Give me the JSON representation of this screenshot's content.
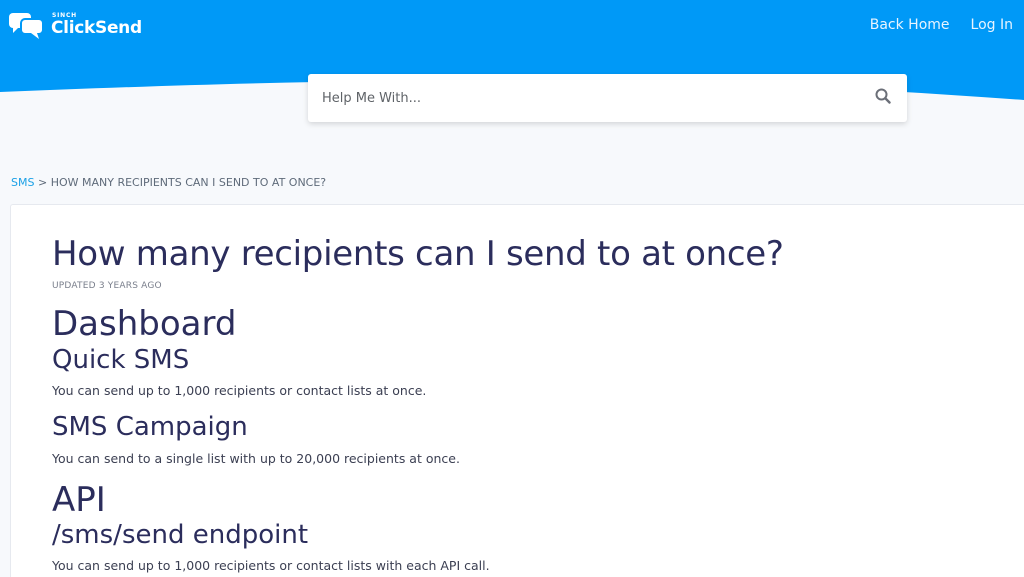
{
  "header": {
    "logo_brand_small": "SINCH",
    "logo_brand": "ClickSend",
    "nav": {
      "back_home": "Back Home",
      "log_in": "Log In"
    },
    "accent": "#0099f7"
  },
  "search": {
    "placeholder": "Help Me With...",
    "icon": "search-icon"
  },
  "breadcrumb": {
    "category": "SMS",
    "separator": ">",
    "current": "HOW MANY RECIPIENTS CAN I SEND TO AT ONCE?"
  },
  "article": {
    "title": "How many recipients can I send to at once?",
    "updated": "UPDATED 3 YEARS AGO",
    "sections": [
      {
        "heading": "Dashboard"
      },
      {
        "subheading": "Quick SMS",
        "text": "You can send up to 1,000 recipients or contact lists at once."
      },
      {
        "subheading": "SMS Campaign",
        "text": "You can send to a single list with up to 20,000 recipients at once."
      },
      {
        "heading": "API"
      },
      {
        "subheading": "/sms/send endpoint",
        "text": "You can send up to 1,000 recipients or contact lists with each API call."
      }
    ]
  }
}
